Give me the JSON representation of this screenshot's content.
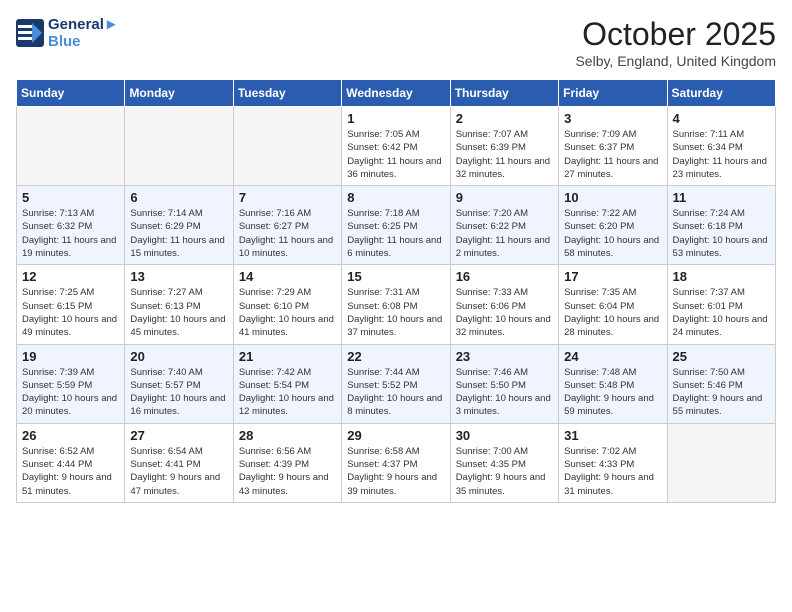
{
  "header": {
    "logo_line1": "General",
    "logo_line2": "Blue",
    "month": "October 2025",
    "location": "Selby, England, United Kingdom"
  },
  "weekdays": [
    "Sunday",
    "Monday",
    "Tuesday",
    "Wednesday",
    "Thursday",
    "Friday",
    "Saturday"
  ],
  "weeks": [
    [
      {
        "day": "",
        "empty": true
      },
      {
        "day": "",
        "empty": true
      },
      {
        "day": "",
        "empty": true
      },
      {
        "day": "1",
        "sunrise": "7:05 AM",
        "sunset": "6:42 PM",
        "daylight": "11 hours and 36 minutes."
      },
      {
        "day": "2",
        "sunrise": "7:07 AM",
        "sunset": "6:39 PM",
        "daylight": "11 hours and 32 minutes."
      },
      {
        "day": "3",
        "sunrise": "7:09 AM",
        "sunset": "6:37 PM",
        "daylight": "11 hours and 27 minutes."
      },
      {
        "day": "4",
        "sunrise": "7:11 AM",
        "sunset": "6:34 PM",
        "daylight": "11 hours and 23 minutes."
      }
    ],
    [
      {
        "day": "5",
        "sunrise": "7:13 AM",
        "sunset": "6:32 PM",
        "daylight": "11 hours and 19 minutes."
      },
      {
        "day": "6",
        "sunrise": "7:14 AM",
        "sunset": "6:29 PM",
        "daylight": "11 hours and 15 minutes."
      },
      {
        "day": "7",
        "sunrise": "7:16 AM",
        "sunset": "6:27 PM",
        "daylight": "11 hours and 10 minutes."
      },
      {
        "day": "8",
        "sunrise": "7:18 AM",
        "sunset": "6:25 PM",
        "daylight": "11 hours and 6 minutes."
      },
      {
        "day": "9",
        "sunrise": "7:20 AM",
        "sunset": "6:22 PM",
        "daylight": "11 hours and 2 minutes."
      },
      {
        "day": "10",
        "sunrise": "7:22 AM",
        "sunset": "6:20 PM",
        "daylight": "10 hours and 58 minutes."
      },
      {
        "day": "11",
        "sunrise": "7:24 AM",
        "sunset": "6:18 PM",
        "daylight": "10 hours and 53 minutes."
      }
    ],
    [
      {
        "day": "12",
        "sunrise": "7:25 AM",
        "sunset": "6:15 PM",
        "daylight": "10 hours and 49 minutes."
      },
      {
        "day": "13",
        "sunrise": "7:27 AM",
        "sunset": "6:13 PM",
        "daylight": "10 hours and 45 minutes."
      },
      {
        "day": "14",
        "sunrise": "7:29 AM",
        "sunset": "6:10 PM",
        "daylight": "10 hours and 41 minutes."
      },
      {
        "day": "15",
        "sunrise": "7:31 AM",
        "sunset": "6:08 PM",
        "daylight": "10 hours and 37 minutes."
      },
      {
        "day": "16",
        "sunrise": "7:33 AM",
        "sunset": "6:06 PM",
        "daylight": "10 hours and 32 minutes."
      },
      {
        "day": "17",
        "sunrise": "7:35 AM",
        "sunset": "6:04 PM",
        "daylight": "10 hours and 28 minutes."
      },
      {
        "day": "18",
        "sunrise": "7:37 AM",
        "sunset": "6:01 PM",
        "daylight": "10 hours and 24 minutes."
      }
    ],
    [
      {
        "day": "19",
        "sunrise": "7:39 AM",
        "sunset": "5:59 PM",
        "daylight": "10 hours and 20 minutes."
      },
      {
        "day": "20",
        "sunrise": "7:40 AM",
        "sunset": "5:57 PM",
        "daylight": "10 hours and 16 minutes."
      },
      {
        "day": "21",
        "sunrise": "7:42 AM",
        "sunset": "5:54 PM",
        "daylight": "10 hours and 12 minutes."
      },
      {
        "day": "22",
        "sunrise": "7:44 AM",
        "sunset": "5:52 PM",
        "daylight": "10 hours and 8 minutes."
      },
      {
        "day": "23",
        "sunrise": "7:46 AM",
        "sunset": "5:50 PM",
        "daylight": "10 hours and 3 minutes."
      },
      {
        "day": "24",
        "sunrise": "7:48 AM",
        "sunset": "5:48 PM",
        "daylight": "9 hours and 59 minutes."
      },
      {
        "day": "25",
        "sunrise": "7:50 AM",
        "sunset": "5:46 PM",
        "daylight": "9 hours and 55 minutes."
      }
    ],
    [
      {
        "day": "26",
        "sunrise": "6:52 AM",
        "sunset": "4:44 PM",
        "daylight": "9 hours and 51 minutes."
      },
      {
        "day": "27",
        "sunrise": "6:54 AM",
        "sunset": "4:41 PM",
        "daylight": "9 hours and 47 minutes."
      },
      {
        "day": "28",
        "sunrise": "6:56 AM",
        "sunset": "4:39 PM",
        "daylight": "9 hours and 43 minutes."
      },
      {
        "day": "29",
        "sunrise": "6:58 AM",
        "sunset": "4:37 PM",
        "daylight": "9 hours and 39 minutes."
      },
      {
        "day": "30",
        "sunrise": "7:00 AM",
        "sunset": "4:35 PM",
        "daylight": "9 hours and 35 minutes."
      },
      {
        "day": "31",
        "sunrise": "7:02 AM",
        "sunset": "4:33 PM",
        "daylight": "9 hours and 31 minutes."
      },
      {
        "day": "",
        "empty": true
      }
    ]
  ],
  "labels": {
    "sunrise": "Sunrise:",
    "sunset": "Sunset:",
    "daylight": "Daylight:"
  }
}
